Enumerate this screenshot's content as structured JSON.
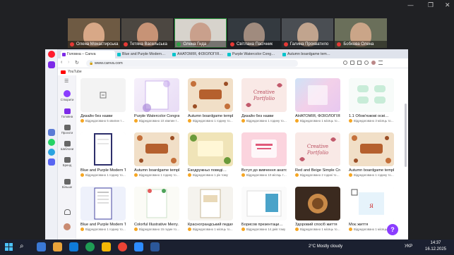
{
  "meeting": {
    "participants": [
      {
        "name": "Олена Монастирська",
        "bg": "#6e5a43",
        "face": "#d8a887",
        "muted": true
      },
      {
        "name": "Тетяна Васельська",
        "bg": "#4c4741",
        "face": "#c79376",
        "muted": true
      },
      {
        "name": "Олена Гнда",
        "bg": "#d7d3cc",
        "face": "#c9a08c",
        "muted": false
      },
      {
        "name": "Світлана Пасічник",
        "bg": "#343a40",
        "face": "#a08b7e",
        "muted": true
      },
      {
        "name": "Галина Прохватило",
        "bg": "#4a4e53",
        "face": "#c1a48e",
        "muted": true
      },
      {
        "name": "Бобкова Олена",
        "bg": "#6a6f5a",
        "face": "#caa588",
        "muted": true
      }
    ]
  },
  "browser": {
    "tabs": [
      {
        "label": "Головна – Canva",
        "color": "#7d2ae8"
      },
      {
        "label": "Blue and Purple Modern…",
        "color": "#00c4cc"
      },
      {
        "label": "АНАТОМІЯ, ФІЗІОЛОГІЯ…",
        "color": "#00c4cc"
      },
      {
        "label": "Purple Watercolor Cong…",
        "color": "#00c4cc"
      },
      {
        "label": "Autumn boardgame tem…",
        "color": "#00c4cc"
      }
    ],
    "url": "www.canva.com",
    "bookmark": "YouTube"
  },
  "canva_sidebar": {
    "items": [
      {
        "label": "Створити",
        "color": "#8b3dff"
      },
      {
        "label": "Головна",
        "color": "#7d2ae8"
      },
      {
        "label": "Проєкти",
        "color": "#666"
      },
      {
        "label": "Шаблони",
        "color": "#666"
      },
      {
        "label": "Бренд",
        "color": "#666"
      },
      {
        "label": "Більше",
        "color": "#666"
      }
    ]
  },
  "designs": [
    {
      "title": "Дизайн без назви",
      "subtitle": "Відредаговано 5 хвилин т…",
      "style": "blank"
    },
    {
      "title": "Purple Watercolor Congra…",
      "subtitle": "Відредаговано 10 хвилин т…",
      "style": "purple"
    },
    {
      "title": "Autumn boardgame templ…",
      "subtitle": "Відредаговано 1 годину то…",
      "style": "autumn"
    },
    {
      "title": "Дизайн без назви",
      "subtitle": "Відредаговано 1 годину то…",
      "style": "creative"
    },
    {
      "title": "АНАТОМІЯ, ФІЗІОЛОГІЯ І …",
      "subtitle": "Відредаговано 1 місяць то…",
      "style": "anatomy"
    },
    {
      "title": "1.1 Обов'язкові осві…",
      "subtitle": "Відредаговано 3 місяць то…",
      "style": "mint"
    },
    {
      "title": "Blue and Purple Modern T…",
      "subtitle": "Відредаговано 1 годину то…",
      "style": "bluedoc"
    },
    {
      "title": "Autumn boardgame templ…",
      "subtitle": "Відредаговано 1 годину то…",
      "style": "autumn"
    },
    {
      "title": "Екодружньо поведі…",
      "subtitle": "Відредаговано 1 рік тому",
      "style": "eco"
    },
    {
      "title": "Вступ до вивчення анато…",
      "subtitle": "Відредаговано 10 місяць т…",
      "style": "intro"
    },
    {
      "title": "Red and Beige Simple Cre…",
      "subtitle": "Відредаговано 2 годині то…",
      "style": "creative"
    },
    {
      "title": "Autumn boardgame templ…",
      "subtitle": "Відредаговано 1 годину то…",
      "style": "autumn"
    },
    {
      "title": "Blue and Purple Modern T…",
      "subtitle": "Відредаговано 1 годину то…",
      "style": "bluedoc2"
    },
    {
      "title": "Colorful Illustrative Merry…",
      "subtitle": "Відредаговано 15 годин то…",
      "style": "merry"
    },
    {
      "title": "Краснограндський педаго…",
      "subtitle": "Відредаговано 1 місяць то…",
      "style": "teacher"
    },
    {
      "title": "Борисов презентаци…",
      "subtitle": "Відредаговано 14 днів тому",
      "style": "borysov"
    },
    {
      "title": "Здоровий спосіб життя",
      "subtitle": "Відредаговано 1 місяць то…",
      "style": "food"
    },
    {
      "title": "Моє життя",
      "subtitle": "Відредаговано 1 місяць то…",
      "style": "life"
    }
  ],
  "taskbar": {
    "weather": "2°C  Mostly cloudy",
    "lang": "УКР",
    "time": "14:37",
    "date": "16.12.2025",
    "apps": [
      "#3a78d6",
      "#e8a33a",
      "#0f7bd8",
      "#1f9d55",
      "#f2b705",
      "#ea4335",
      "#2d8cff",
      "#2b579a"
    ]
  }
}
